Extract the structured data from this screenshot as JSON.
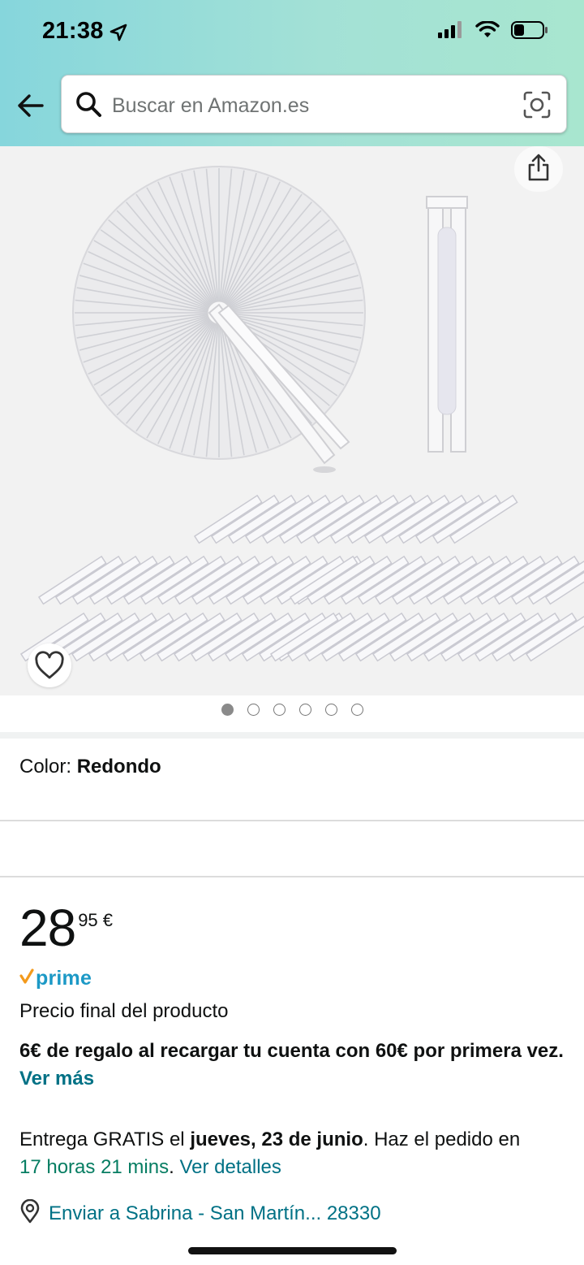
{
  "status_bar": {
    "time": "21:38"
  },
  "search": {
    "placeholder": "Buscar en Amazon.es"
  },
  "gallery": {
    "dot_count": 6,
    "active_index": 0
  },
  "color": {
    "label": "Color: ",
    "value": "Redondo"
  },
  "price": {
    "whole": "28",
    "fraction": "95 €"
  },
  "prime": {
    "label": "prime"
  },
  "final_price_text": "Precio final del producto",
  "promo": {
    "text": "6€ de regalo al recargar tu cuenta con 60€ por primera vez. ",
    "link": "Ver más"
  },
  "delivery": {
    "prefix": "Entrega GRATIS el ",
    "date": "jueves, 23 de junio",
    "middle": ". Haz el pedido en ",
    "countdown": "17 horas 21 mins",
    "sep": ". ",
    "details_link": "Ver detalles"
  },
  "ship_to": {
    "label": "Enviar a Sabrina - San Martín... 28330"
  },
  "colors": {
    "link": "#007185",
    "prime": "#1c99c6",
    "countdown": "#067d62",
    "header_start": "#86d6dc",
    "header_end": "#a8e6cf"
  }
}
